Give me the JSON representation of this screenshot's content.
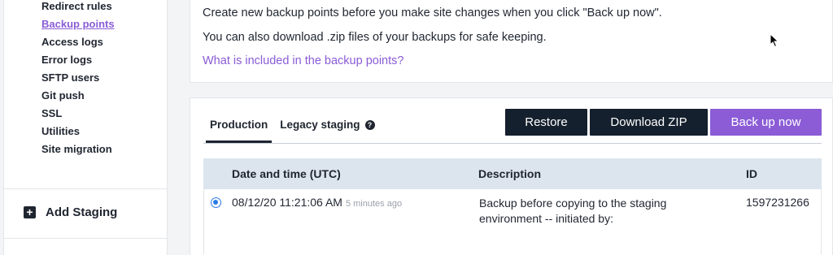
{
  "sidebar": {
    "items": [
      {
        "label": "Redirect rules",
        "active": false
      },
      {
        "label": "Backup points",
        "active": true
      },
      {
        "label": "Access logs",
        "active": false
      },
      {
        "label": "Error logs",
        "active": false
      },
      {
        "label": "SFTP users",
        "active": false
      },
      {
        "label": "Git push",
        "active": false
      },
      {
        "label": "SSL",
        "active": false
      },
      {
        "label": "Utilities",
        "active": false
      },
      {
        "label": "Site migration",
        "active": false
      }
    ],
    "add_staging_label": "Add Staging",
    "add_staging_icon": "plus-square-icon"
  },
  "info": {
    "line1": "Create new backup points before you make site changes when you click \"Back up now\".",
    "line2": "You can also download .zip files of your backups for safe keeping.",
    "link": "What is included in the backup points?"
  },
  "backups": {
    "tabs": [
      {
        "label": "Production",
        "active": true
      },
      {
        "label": "Legacy staging",
        "active": false,
        "icon": "help-circle-icon"
      }
    ],
    "buttons": {
      "restore": "Restore",
      "download": "Download ZIP",
      "backup": "Back up now"
    },
    "table": {
      "columns": [
        "Date and time (UTC)",
        "Description",
        "ID"
      ],
      "rows": [
        {
          "selected": true,
          "datetime": "08/12/20 11:21:06 AM",
          "ago": "5 minutes ago",
          "description": "Backup before copying to the staging environment -- initiated by:",
          "id": "1597231266"
        }
      ]
    }
  },
  "colors": {
    "accent": "#8b5cd6",
    "dark_button": "#15202e",
    "table_header": "#dce5ee",
    "radio": "#2a7be4"
  }
}
